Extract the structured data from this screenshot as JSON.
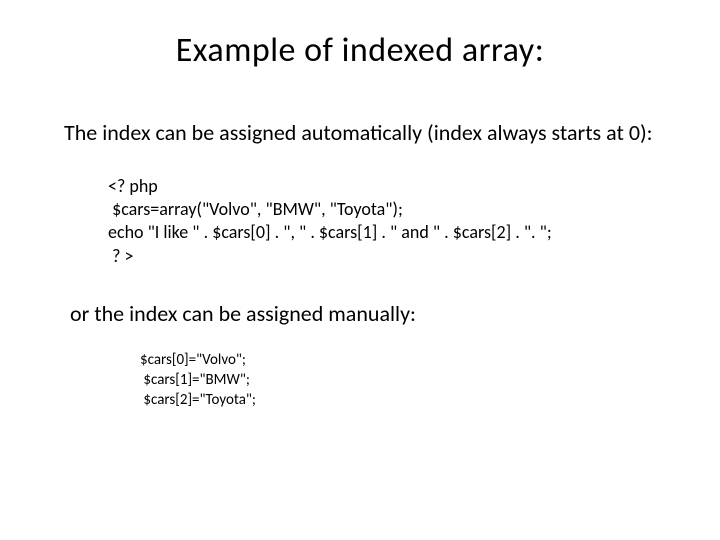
{
  "title": "Example of indexed array:",
  "para1": "The index can be assigned automatically (index always starts at 0):",
  "code1": "<? php\n $cars=array(\"Volvo\", \"BMW\", \"Toyota\");\necho \"I like \" . $cars[0] . \", \" . $cars[1] . \" and \" . $cars[2] . \". \";\n ? >",
  "para2": "or the index can be assigned manually:",
  "code2": "$cars[0]=\"Volvo\";\n $cars[1]=\"BMW\";\n $cars[2]=\"Toyota\";"
}
